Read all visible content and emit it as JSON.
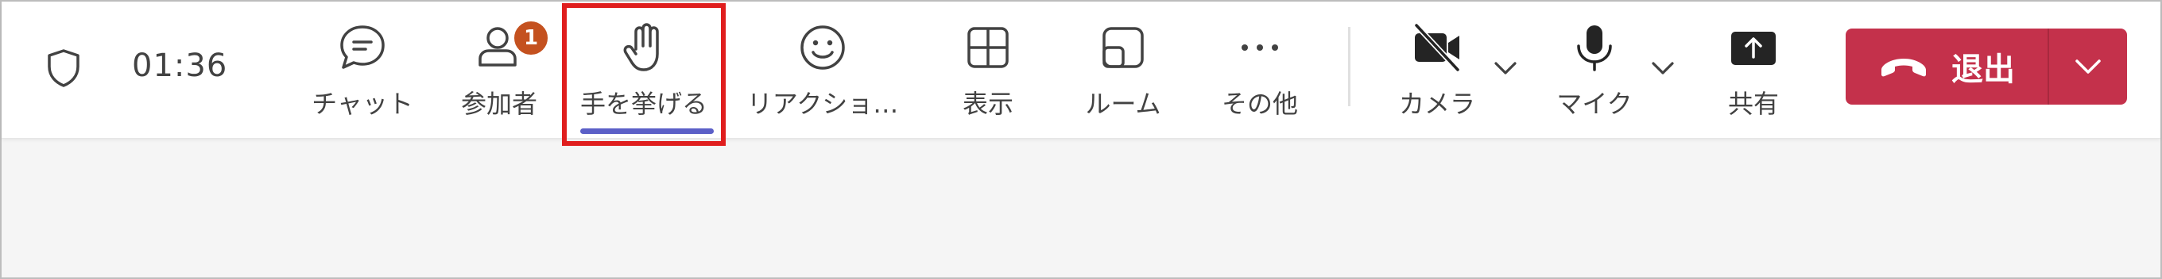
{
  "timer": "01:36",
  "buttons": {
    "chat": "チャット",
    "participants": "参加者",
    "participants_badge": "1",
    "raise_hand": "手を挙げる",
    "reactions": "リアクショ…",
    "view": "表示",
    "rooms": "ルーム",
    "more": "その他",
    "camera": "カメラ",
    "mic": "マイク",
    "share": "共有",
    "leave": "退出"
  },
  "colors": {
    "leave_bg": "#c4314b",
    "selected_underline": "#5b5fc7",
    "badge_bg": "#c4511f",
    "highlight_border": "#e01e1e"
  },
  "icons": {
    "shield": "shield-icon",
    "chat": "chat-icon",
    "participants": "people-icon",
    "raise_hand": "hand-icon",
    "reactions": "smiley-icon",
    "view": "grid-icon",
    "rooms": "rooms-icon",
    "more": "more-icon",
    "camera": "camera-off-icon",
    "mic": "microphone-icon",
    "share": "share-icon",
    "leave": "phone-hangup-icon"
  }
}
